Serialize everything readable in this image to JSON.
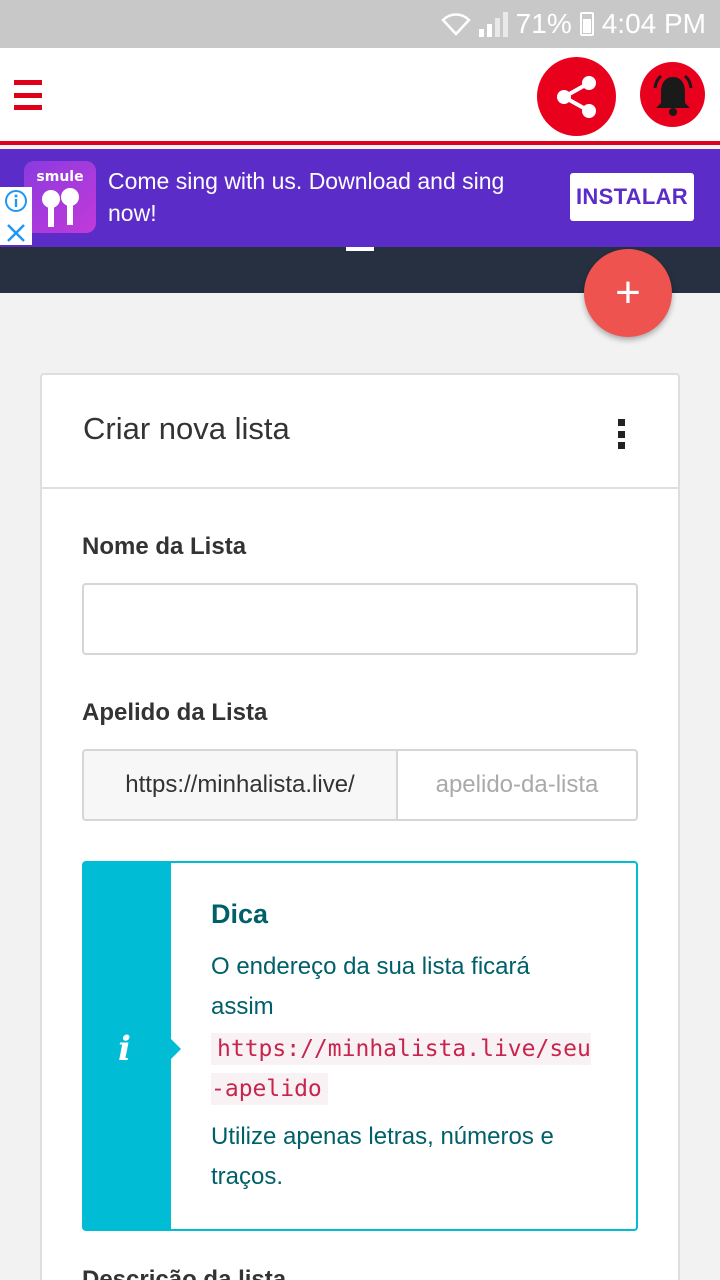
{
  "status_bar": {
    "battery": "71%",
    "time": "4:04 PM"
  },
  "app_bar": {
    "menu_icon": "hamburger-icon",
    "share_icon": "share-icon",
    "bell_icon": "bell-icon",
    "accent": "#e1001a"
  },
  "ad": {
    "brand": "smule",
    "text": "Come sing with us. Download and sing now!",
    "install_label": "INSTALAR",
    "background": "#5c2cc9"
  },
  "fab": {
    "label": "+",
    "color": "#ef5350"
  },
  "card": {
    "title": "Criar nova lista",
    "list_name": {
      "label": "Nome da Lista",
      "value": "",
      "placeholder": ""
    },
    "list_alias": {
      "label": "Apelido da Lista",
      "prefix": "https://minhalista.live/",
      "placeholder": "apelido-da-lista"
    },
    "tip": {
      "icon": "i",
      "title": "Dica",
      "text1": "O endereço da sua lista ficará assim",
      "code": "https://minhalista.live/seu-apelido",
      "text2": "Utilize apenas letras, números e traços."
    },
    "next_label": "Descrição da lista"
  }
}
